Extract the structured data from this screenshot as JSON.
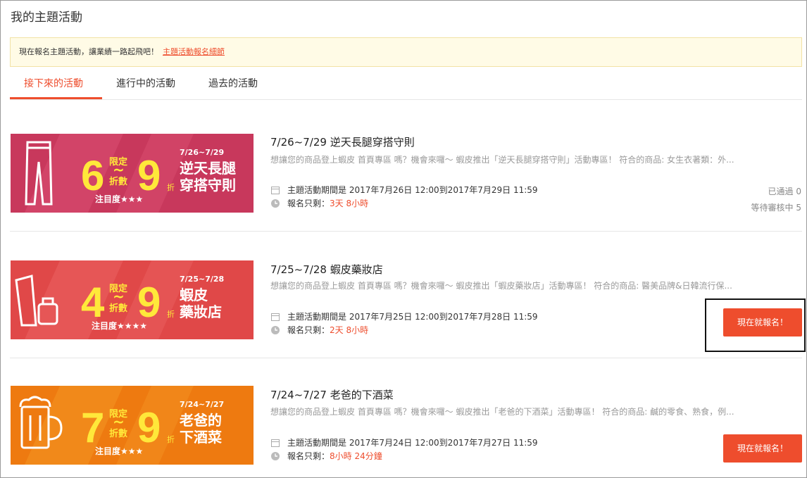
{
  "page": {
    "title": "我的主題活動"
  },
  "notice": {
    "text": "現在報名主題活動，讓業績一路起飛吧！",
    "link": "主題活動報名細節"
  },
  "tabs": [
    {
      "label": "接下來的活動",
      "active": true
    },
    {
      "label": "進行中的活動",
      "active": false
    },
    {
      "label": "過去的活動",
      "active": false
    }
  ],
  "labels": {
    "period_prefix": "主題活動期間是",
    "signup_prefix": "報名只剩："
  },
  "events": [
    {
      "title": "7/26~7/29 逆天長腿穿搭守則",
      "desc": "想讓您的商品登上蝦皮 首頁專區 嗎？機會來囉～ 蝦皮推出「逆天長腿穿搭守則」活動專區！ 符合的商品: 女生衣著類：外...",
      "period": "2017年7月26日 12:00到2017年7月29日 11:59",
      "remaining": "3天 8小時",
      "stats": [
        "已通過 0",
        "等待審核中 5"
      ],
      "banner": {
        "dates": "7/26~7/29",
        "big1": "6",
        "big2": "9",
        "line1": "限定",
        "line2": "折數",
        "zhe": "折",
        "name1": "逆天長腿",
        "name2": "穿搭守則",
        "rating": "注目度★★★",
        "color1": "#c8385c",
        "color2": "#d94d6f",
        "icon": "pants-icon"
      }
    },
    {
      "title": "7/25~7/28 蝦皮藥妝店",
      "desc": "想讓您的商品登上蝦皮 首頁專區 嗎？機會來囉～ 蝦皮推出「蝦皮藥妝店」活動專區！ 符合的商品: 醫美品牌&日韓流行保...",
      "period": "2017年7月25日 12:00到2017年7月28日 11:59",
      "remaining": "2天 8小時",
      "button": "現在就報名！",
      "banner": {
        "dates": "7/25~7/28",
        "big1": "4",
        "big2": "9",
        "line1": "限定",
        "line2": "折數",
        "zhe": "折",
        "name1": "蝦皮",
        "name2": "藥妝店",
        "rating": "注目度★★★★",
        "color1": "#e04848",
        "color2": "#ea6060",
        "icon": "cosmetics-icon"
      }
    },
    {
      "title": "7/24~7/27 老爸的下酒菜",
      "desc": "想讓您的商品登上蝦皮 首頁專區 嗎？機會來囉～ 蝦皮推出「老爸的下酒菜」活動專區！ 符合的商品: 鹹的零食、熟食，例...",
      "period": "2017年7月24日 12:00到2017年7月27日 11:59",
      "remaining": "8小時 24分鐘",
      "button": "現在就報名！",
      "banner": {
        "dates": "7/24~7/27",
        "big1": "7",
        "big2": "9",
        "line1": "限定",
        "line2": "折數",
        "zhe": "折",
        "name1": "老爸的",
        "name2": "下酒菜",
        "rating": "注目度★★★",
        "color1": "#ee7a10",
        "color2": "#f39222",
        "icon": "beer-mug-icon"
      }
    }
  ]
}
